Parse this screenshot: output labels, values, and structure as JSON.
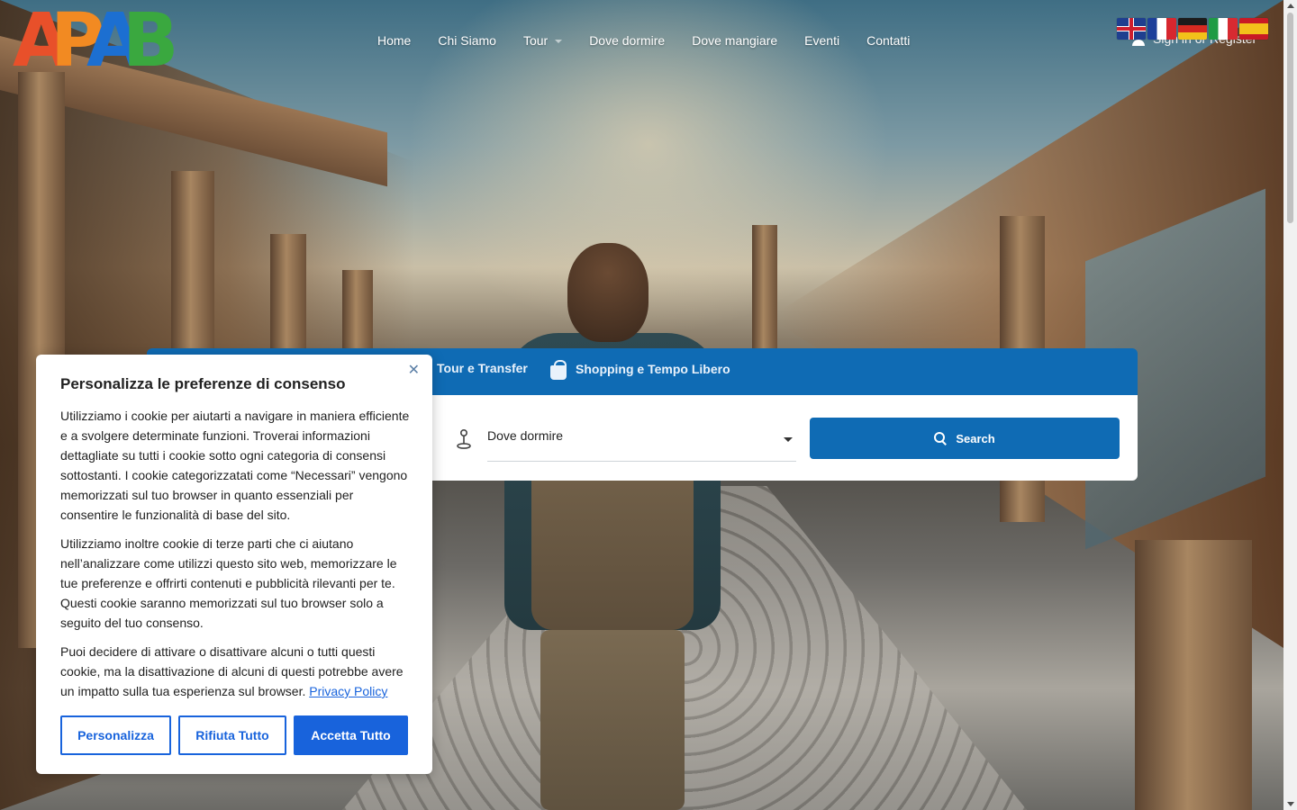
{
  "brand": {
    "logo_letters": [
      "A",
      "P",
      "A",
      "B"
    ],
    "logo_colors": [
      "#e8502a",
      "#f28a22",
      "#1c6fd1",
      "#3aa83f"
    ]
  },
  "nav": {
    "items": [
      {
        "label": "Home"
      },
      {
        "label": "Chi Siamo"
      },
      {
        "label": "Tour",
        "has_dropdown": true
      },
      {
        "label": "Dove dormire"
      },
      {
        "label": "Dove mangiare"
      },
      {
        "label": "Eventi"
      },
      {
        "label": "Contatti"
      }
    ]
  },
  "account": {
    "label": "Sign in or Register",
    "icon": "user-icon"
  },
  "languages": [
    {
      "code": "en",
      "icon": "uk-flag-icon"
    },
    {
      "code": "fr",
      "icon": "france-flag-icon"
    },
    {
      "code": "de",
      "icon": "germany-flag-icon"
    },
    {
      "code": "it",
      "icon": "italy-flag-icon"
    },
    {
      "code": "es",
      "icon": "spain-flag-icon"
    }
  ],
  "search_panel": {
    "tabs": [
      {
        "label": "Tour e Transfer"
      },
      {
        "label": "Shopping e Tempo Libero",
        "icon": "shopping-bag-icon"
      }
    ],
    "category_select": {
      "value": "Dove dormire"
    },
    "search_button": {
      "label": "Search",
      "icon": "search-icon"
    },
    "accent_color": "#0f6bb4"
  },
  "consent": {
    "title": "Personalizza le preferenze di consenso",
    "paragraph1": "Utilizziamo i cookie per aiutarti a navigare in maniera efficiente e a svolgere determinate funzioni. Troverai informazioni dettagliate su tutti i cookie sotto ogni categoria di consensi sottostanti. I cookie categorizzatati come “Necessari” vengono memorizzati sul tuo browser in quanto essenziali per consentire le funzionalità di base del sito.",
    "paragraph2": "Utilizziamo inoltre cookie di terze parti che ci aiutano nell’analizzare come utilizzi questo sito web, memorizzare le tue preferenze e offrirti contenuti e pubblicità rilevanti per te. Questi cookie saranno memorizzati sul tuo browser solo a seguito del tuo consenso.",
    "paragraph3": "Puoi decidere di attivare o disattivare alcuni o tutti questi cookie, ma la disattivazione di alcuni di questi potrebbe avere un impatto sulla tua esperienza sul browser.",
    "privacy_link": "Privacy Policy",
    "close_symbol": "✕",
    "buttons": {
      "customize": "Personalizza",
      "reject": "Rifiuta Tutto",
      "accept": "Accetta Tutto"
    },
    "accent_color": "#1863dc"
  }
}
